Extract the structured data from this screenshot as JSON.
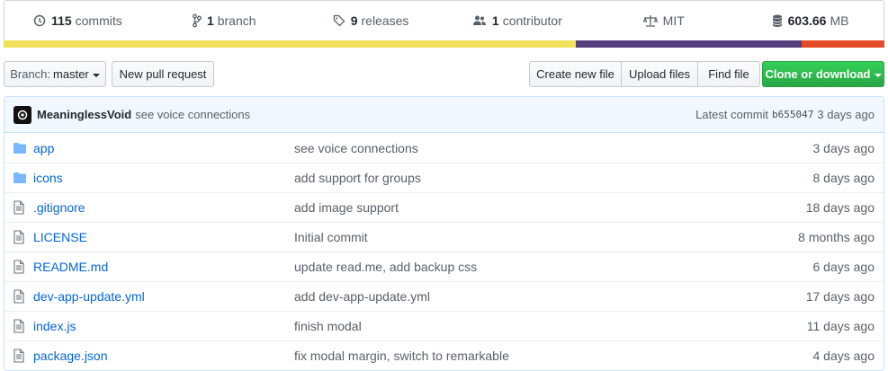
{
  "summary": {
    "commits": {
      "count": "115",
      "label": "commits",
      "icon": "history-icon"
    },
    "branches": {
      "count": "1",
      "label": "branch",
      "icon": "branch-icon"
    },
    "releases": {
      "count": "9",
      "label": "releases",
      "icon": "tag-icon"
    },
    "contributors": {
      "count": "1",
      "label": "contributor",
      "icon": "people-icon"
    },
    "license": {
      "label": "MIT",
      "icon": "law-icon"
    },
    "size": {
      "count": "603.66",
      "label": "MB",
      "icon": "database-icon"
    }
  },
  "languages": [
    {
      "color": "#f1e05a",
      "percent": 65
    },
    {
      "color": "#563d7c",
      "percent": 25.6
    },
    {
      "color": "#e34c26",
      "percent": 9.4
    }
  ],
  "toolbar": {
    "branch_prefix": "Branch:",
    "branch_name": "master",
    "new_pull_request": "New pull request",
    "create_new_file": "Create new file",
    "upload_files": "Upload files",
    "find_file": "Find file",
    "clone_or_download": "Clone or download"
  },
  "latest_commit": {
    "author": "MeaninglessVoid",
    "message": "see voice connections",
    "prefix": "Latest commit",
    "sha": "b655047",
    "age": "3 days ago"
  },
  "files": [
    {
      "type": "dir",
      "name": "app",
      "message": "see voice connections",
      "age": "3 days ago"
    },
    {
      "type": "dir",
      "name": "icons",
      "message": "add support for groups",
      "age": "8 days ago"
    },
    {
      "type": "file",
      "name": ".gitignore",
      "message": "add image support",
      "age": "18 days ago"
    },
    {
      "type": "file",
      "name": "LICENSE",
      "message": "Initial commit",
      "age": "8 months ago"
    },
    {
      "type": "file",
      "name": "README.md",
      "message": "update read.me, add backup css",
      "age": "6 days ago"
    },
    {
      "type": "file",
      "name": "dev-app-update.yml",
      "message": "add dev-app-update.yml",
      "age": "17 days ago"
    },
    {
      "type": "file",
      "name": "index.js",
      "message": "finish modal",
      "age": "11 days ago"
    },
    {
      "type": "file",
      "name": "package.json",
      "message": "fix modal margin, switch to remarkable",
      "age": "4 days ago"
    }
  ]
}
